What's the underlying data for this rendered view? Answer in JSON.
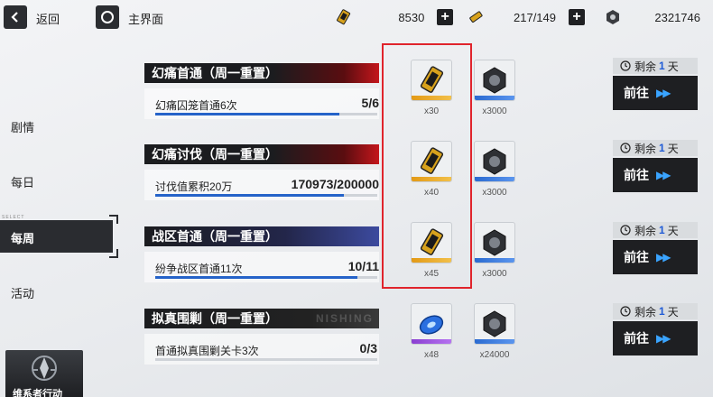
{
  "topbar": {
    "back_label": "返回",
    "home_label": "主界面",
    "resources": [
      {
        "icon": "gold-ticket-icon",
        "value": "8530"
      },
      {
        "icon": "stamina-ticket-icon",
        "value": "217/149"
      },
      {
        "icon": "hex-nut-currency-icon",
        "value": "2321746"
      }
    ]
  },
  "sidebar": {
    "items": [
      {
        "label": "剧情"
      },
      {
        "label": "每日"
      },
      {
        "label": "每周"
      },
      {
        "label": "活动"
      }
    ],
    "select_tag": "SELECT",
    "active_index": 2,
    "bottom_badge": "维系者行动"
  },
  "tasks": [
    {
      "title": "幻痛首通（周一重置）",
      "desc": "幻痛囚笼首通6次",
      "progress": "5/6",
      "progress_ratio": 0.83,
      "rewards": [
        {
          "icon": "gold-ticket-icon",
          "count": "x30"
        },
        {
          "icon": "hex-nut-icon",
          "count": "x3000"
        }
      ],
      "remain_prefix": "剩余",
      "remain_num": "1",
      "remain_unit": "天",
      "go_label": "前往"
    },
    {
      "title": "幻痛讨伐（周一重置）",
      "desc": "讨伐值累积20万",
      "progress": "170973/200000",
      "progress_ratio": 0.85,
      "rewards": [
        {
          "icon": "gold-ticket-icon",
          "count": "x40"
        },
        {
          "icon": "hex-nut-icon",
          "count": "x3000"
        }
      ],
      "remain_prefix": "剩余",
      "remain_num": "1",
      "remain_unit": "天",
      "go_label": "前往"
    },
    {
      "title": "战区首通（周一重置）",
      "desc": "纷争战区首通11次",
      "progress": "10/11",
      "progress_ratio": 0.91,
      "rewards": [
        {
          "icon": "gold-ticket-icon",
          "count": "x45"
        },
        {
          "icon": "hex-nut-icon",
          "count": "x3000"
        }
      ],
      "remain_prefix": "剩余",
      "remain_num": "1",
      "remain_unit": "天",
      "go_label": "前往"
    },
    {
      "title": "拟真围剿（周一重置）",
      "title_ghost": "NISHING",
      "desc": "首通拟真围剿关卡3次",
      "progress": "0/3",
      "progress_ratio": 0.0,
      "rewards": [
        {
          "icon": "blue-disc-icon",
          "count": "x48"
        },
        {
          "icon": "hex-nut-icon",
          "count": "x24000"
        }
      ],
      "remain_prefix": "剩余",
      "remain_num": "1",
      "remain_unit": "天",
      "go_label": "前往"
    }
  ],
  "colors": {
    "accent_blue": "#2563c9",
    "highlight_red": "#e0242c",
    "title_red": "#c4161c"
  }
}
